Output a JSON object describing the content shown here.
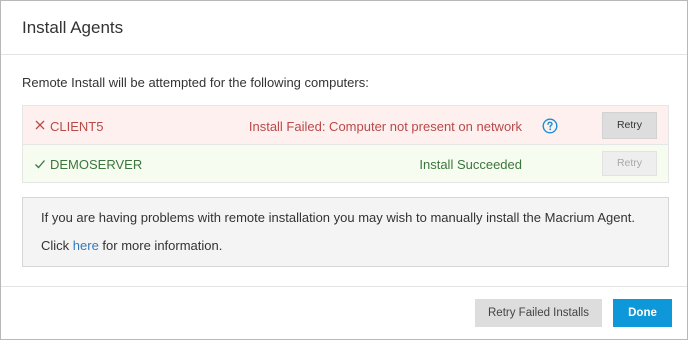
{
  "dialog": {
    "title": "Install Agents",
    "intro_text": "Remote Install will be attempted for the following computers:"
  },
  "results": [
    {
      "status": "failed",
      "status_icon": "x-icon",
      "computer": "CLIENT5",
      "message": "Install Failed: Computer not present on network",
      "help_icon": "question-circle-icon",
      "retry_label": "Retry",
      "retry_enabled": true
    },
    {
      "status": "success",
      "status_icon": "check-icon",
      "computer": "DEMOSERVER",
      "message": "Install Succeeded",
      "retry_label": "Retry",
      "retry_enabled": false
    }
  ],
  "info": {
    "line1": "If you are having problems with remote installation you may wish to manually install the Macrium Agent.",
    "line2_prefix": "Click ",
    "link_text": "here",
    "line2_suffix": " for more information."
  },
  "footer": {
    "retry_failed_label": "Retry Failed Installs",
    "done_label": "Done"
  },
  "colors": {
    "failed_text": "#b94a48",
    "failed_bg": "#fdf0ef",
    "success_text": "#3c763d",
    "success_bg": "#f7fcf1",
    "link": "#337ab7",
    "primary_button": "#0e98d9",
    "help_icon": "#1a8fd4"
  }
}
